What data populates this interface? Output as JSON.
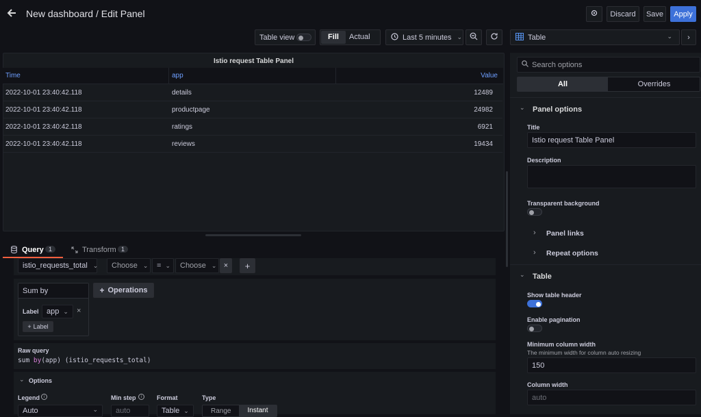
{
  "header": {
    "title": "New dashboard / Edit Panel",
    "discard": "Discard",
    "save": "Save",
    "apply": "Apply"
  },
  "toolbar": {
    "table_view": "Table view",
    "fill": "Fill",
    "actual": "Actual",
    "time_range": "Last 5 minutes",
    "visualization": "Table"
  },
  "panel": {
    "title": "Istio request Table Panel",
    "columns": [
      "Time",
      "app",
      "Value"
    ],
    "rows": [
      [
        "2022-10-01 23:40:42.118",
        "details",
        "12489"
      ],
      [
        "2022-10-01 23:40:42.118",
        "productpage",
        "24982"
      ],
      [
        "2022-10-01 23:40:42.118",
        "ratings",
        "6921"
      ],
      [
        "2022-10-01 23:40:42.118",
        "reviews",
        "19434"
      ]
    ]
  },
  "query": {
    "tab_query": "Query",
    "tab_query_count": "1",
    "tab_transform": "Transform",
    "tab_transform_count": "1",
    "metric": "istio_requests_total",
    "label_choose": "Choose",
    "operator": "=",
    "value_choose": "Choose",
    "op_name": "Sum by",
    "op_label": "Label",
    "op_label_value": "app",
    "add_label": "Label",
    "operations": "Operations",
    "raw_query_title": "Raw query",
    "raw_fn": "sum",
    "raw_by": "by",
    "raw_app": "(app)",
    "raw_metric": "(istio_requests_total)",
    "options_title": "Options",
    "legend_label": "Legend",
    "legend_value": "Auto",
    "min_step_label": "Min step",
    "min_step_placeholder": "auto",
    "format_label": "Format",
    "format_value": "Table",
    "type_label": "Type",
    "type_range": "Range",
    "type_instant": "Instant"
  },
  "options": {
    "search_placeholder": "Search options",
    "tab_all": "All",
    "tab_overrides": "Overrides",
    "panel_options": "Panel options",
    "title_label": "Title",
    "title_value": "Istio request Table Panel",
    "description_label": "Description",
    "transparent_label": "Transparent background",
    "panel_links": "Panel links",
    "repeat_options": "Repeat options",
    "table_section": "Table",
    "show_header_label": "Show table header",
    "show_header_on": true,
    "pagination_label": "Enable pagination",
    "pagination_on": false,
    "min_col_width_label": "Minimum column width",
    "min_col_width_desc": "The minimum width for column auto resizing",
    "min_col_width_value": "150",
    "col_width_label": "Column width",
    "col_width_placeholder": "auto"
  }
}
